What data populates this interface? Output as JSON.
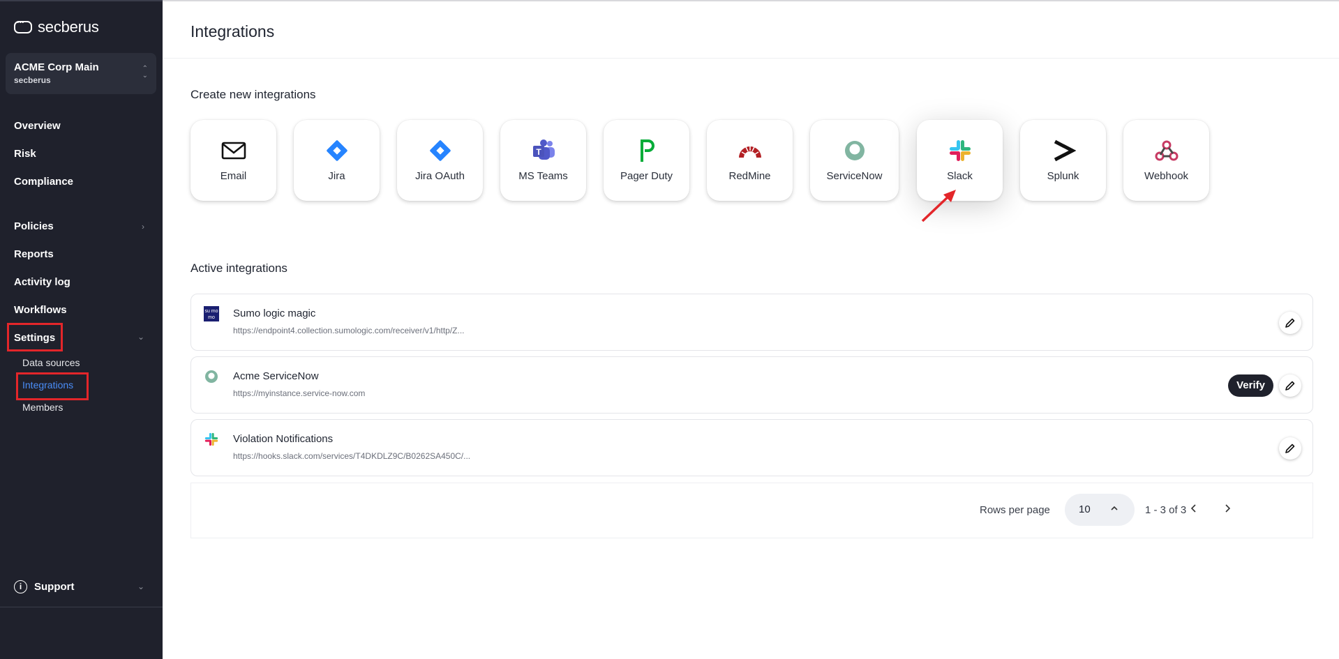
{
  "brand": {
    "name": "secberus"
  },
  "org": {
    "name": "ACME Corp Main",
    "sub": "secberus"
  },
  "nav": {
    "overview": "Overview",
    "risk": "Risk",
    "compliance": "Compliance",
    "policies": "Policies",
    "reports": "Reports",
    "activity_log": "Activity log",
    "workflows": "Workflows",
    "settings": "Settings",
    "settings_sub": [
      "Data sources",
      "Integrations",
      "Members"
    ],
    "support": "Support"
  },
  "page": {
    "title": "Integrations",
    "create_title": "Create new integrations",
    "active_title": "Active integrations"
  },
  "integration_types": [
    {
      "label": "Email",
      "icon": "envelope-icon"
    },
    {
      "label": "Jira",
      "icon": "jira-icon"
    },
    {
      "label": "Jira OAuth",
      "icon": "jira-icon"
    },
    {
      "label": "MS Teams",
      "icon": "ms-teams-icon"
    },
    {
      "label": "Pager Duty",
      "icon": "pagerduty-icon"
    },
    {
      "label": "RedMine",
      "icon": "redmine-icon"
    },
    {
      "label": "ServiceNow",
      "icon": "servicenow-icon"
    },
    {
      "label": "Slack",
      "icon": "slack-icon"
    },
    {
      "label": "Splunk",
      "icon": "splunk-icon"
    },
    {
      "label": "Webhook",
      "icon": "webhook-icon"
    }
  ],
  "active_integrations": [
    {
      "name": "Sumo logic magic",
      "url": "https://endpoint4.collection.sumologic.com/receiver/v1/http/Z...",
      "icon": "sumo-logic-icon",
      "logo_text": "su mo"
    },
    {
      "name": "Acme ServiceNow",
      "url": "https://myinstance.service-now.com",
      "icon": "servicenow-icon",
      "verify_label": "Verify"
    },
    {
      "name": "Violation Notifications",
      "url": "https://hooks.slack.com/services/T4DKDLZ9C/B0262SA450C/...",
      "icon": "slack-icon"
    }
  ],
  "pagination": {
    "rows_per_page_label": "Rows per page",
    "rows_per_page": "10",
    "range": "1 - 3 of 3"
  },
  "colors": {
    "sidebar_bg": "#1f212c",
    "active_link": "#4a8df8",
    "highlight": "#e3262a",
    "jira": "#2684ff",
    "pagerduty": "#06ac38",
    "redmine": "#b32024",
    "servicenow": "#81b5a1"
  }
}
